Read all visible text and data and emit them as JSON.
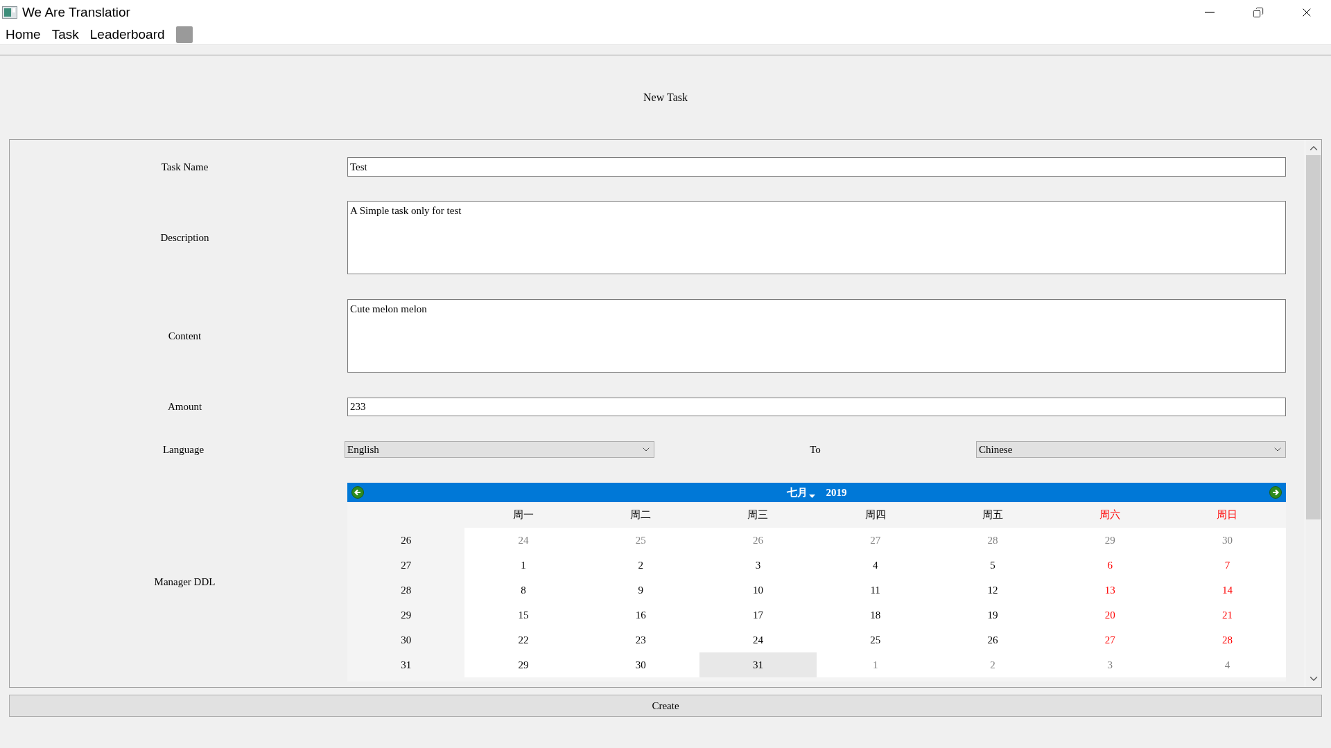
{
  "window": {
    "title": "We Are Translatior"
  },
  "menu": [
    "Home",
    "Task",
    "Leaderboard"
  ],
  "page_title": "New Task",
  "form": {
    "task_name": {
      "label": "Task Name",
      "value": "Test"
    },
    "description": {
      "label": "Description",
      "value": "A Simple task only for test"
    },
    "content": {
      "label": "Content",
      "value": "Cute melon melon"
    },
    "amount": {
      "label": "Amount",
      "value": "233"
    },
    "language": {
      "label": "Language",
      "from": "English",
      "to_label": "To",
      "to": "Chinese"
    },
    "manager_ddl": {
      "label": "Manager DDL",
      "calendar": {
        "month": "七月",
        "year": "2019",
        "weekdays": [
          {
            "label": "周一",
            "weekend": false
          },
          {
            "label": "周二",
            "weekend": false
          },
          {
            "label": "周三",
            "weekend": false
          },
          {
            "label": "周四",
            "weekend": false
          },
          {
            "label": "周五",
            "weekend": false
          },
          {
            "label": "周六",
            "weekend": true
          },
          {
            "label": "周日",
            "weekend": true
          }
        ],
        "weeks": [
          {
            "number": "26",
            "days": [
              {
                "day": "24",
                "outside": true,
                "selected": false
              },
              {
                "day": "25",
                "outside": true,
                "selected": false
              },
              {
                "day": "26",
                "outside": true,
                "selected": false
              },
              {
                "day": "27",
                "outside": true,
                "selected": false
              },
              {
                "day": "28",
                "outside": true,
                "selected": false
              },
              {
                "day": "29",
                "outside": true,
                "selected": false
              },
              {
                "day": "30",
                "outside": true,
                "selected": false
              }
            ]
          },
          {
            "number": "27",
            "days": [
              {
                "day": "1",
                "outside": false,
                "selected": false
              },
              {
                "day": "2",
                "outside": false,
                "selected": false
              },
              {
                "day": "3",
                "outside": false,
                "selected": false
              },
              {
                "day": "4",
                "outside": false,
                "selected": false
              },
              {
                "day": "5",
                "outside": false,
                "selected": false
              },
              {
                "day": "6",
                "outside": false,
                "selected": false
              },
              {
                "day": "7",
                "outside": false,
                "selected": false
              }
            ]
          },
          {
            "number": "28",
            "days": [
              {
                "day": "8",
                "outside": false,
                "selected": false
              },
              {
                "day": "9",
                "outside": false,
                "selected": false
              },
              {
                "day": "10",
                "outside": false,
                "selected": false
              },
              {
                "day": "11",
                "outside": false,
                "selected": false
              },
              {
                "day": "12",
                "outside": false,
                "selected": false
              },
              {
                "day": "13",
                "outside": false,
                "selected": false
              },
              {
                "day": "14",
                "outside": false,
                "selected": false
              }
            ]
          },
          {
            "number": "29",
            "days": [
              {
                "day": "15",
                "outside": false,
                "selected": false
              },
              {
                "day": "16",
                "outside": false,
                "selected": false
              },
              {
                "day": "17",
                "outside": false,
                "selected": false
              },
              {
                "day": "18",
                "outside": false,
                "selected": false
              },
              {
                "day": "19",
                "outside": false,
                "selected": false
              },
              {
                "day": "20",
                "outside": false,
                "selected": false
              },
              {
                "day": "21",
                "outside": false,
                "selected": false
              }
            ]
          },
          {
            "number": "30",
            "days": [
              {
                "day": "22",
                "outside": false,
                "selected": false
              },
              {
                "day": "23",
                "outside": false,
                "selected": false
              },
              {
                "day": "24",
                "outside": false,
                "selected": false
              },
              {
                "day": "25",
                "outside": false,
                "selected": false
              },
              {
                "day": "26",
                "outside": false,
                "selected": false
              },
              {
                "day": "27",
                "outside": false,
                "selected": false
              },
              {
                "day": "28",
                "outside": false,
                "selected": false
              }
            ]
          },
          {
            "number": "31",
            "days": [
              {
                "day": "29",
                "outside": false,
                "selected": false
              },
              {
                "day": "30",
                "outside": false,
                "selected": false
              },
              {
                "day": "31",
                "outside": false,
                "selected": true
              },
              {
                "day": "1",
                "outside": true,
                "selected": false
              },
              {
                "day": "2",
                "outside": true,
                "selected": false
              },
              {
                "day": "3",
                "outside": true,
                "selected": false
              },
              {
                "day": "4",
                "outside": true,
                "selected": false
              }
            ]
          }
        ]
      }
    }
  },
  "create_button": "Create"
}
